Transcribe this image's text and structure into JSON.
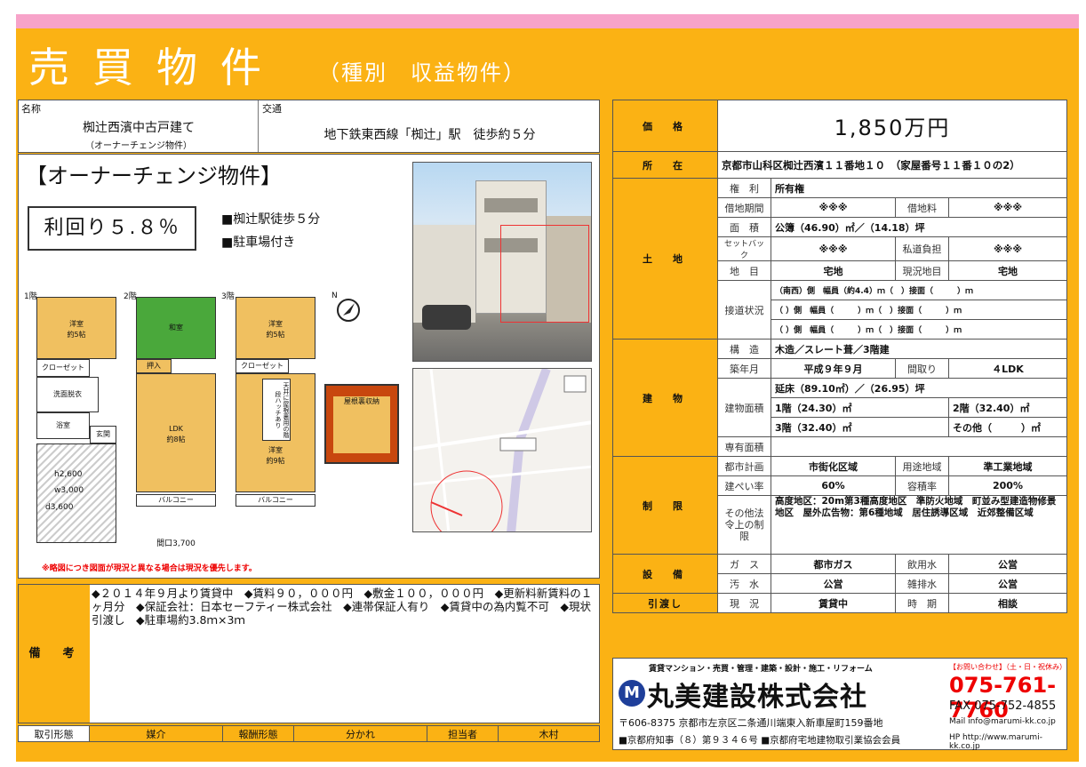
{
  "header": {
    "title": "売買物件",
    "subtitle": "（種別　収益物件）"
  },
  "name": {
    "label": "名称",
    "value": "椥辻西濱中古戸建て",
    "note": "（オーナーチェンジ物件）"
  },
  "access": {
    "label": "交通",
    "value": "地下鉄東西線「椥辻」駅　徒歩約５分"
  },
  "promo": {
    "heading": "【オーナーチェンジ物件】",
    "yield": "利回り５.８％",
    "point1": "■椥辻駅徒歩５分",
    "point2": "■駐車場付き"
  },
  "floorplan": {
    "f1": "1階",
    "f2": "2階",
    "f3": "3階",
    "r_youshitsu1": "洋室\n約5帖",
    "closet": "クローゼット",
    "washroom": "洗面脱衣",
    "bath": "浴室",
    "entrance": "玄関",
    "washitsu": "和室",
    "oshiire": "押入",
    "ldk": "LDK\n約8帖",
    "balcony": "バルコニー",
    "r_youshitsu3a": "洋室\n約5帖",
    "r_youshitsu3b": "洋室\n約9帖",
    "loft_note": "天井に屋根裏用の階段ハッチあり",
    "closet2": "クローゼット",
    "attic": "屋根裏収納",
    "h": "h2,600",
    "w": "w3,000",
    "d": "d3,600",
    "width": "間口3,700",
    "up": "UP",
    "dn": "DN",
    "north": "N",
    "disclaimer": "※略図につき図面が現況と異なる場合は現況を優先します。"
  },
  "price": {
    "label": "価　格",
    "value": "1,850万円"
  },
  "location": {
    "label": "所　在",
    "value": "京都市山科区椥辻西濱１１番地１０　（家屋番号１１番１０の2）"
  },
  "land": {
    "label": "土　地",
    "rights_l": "権　利",
    "rights": "所有権",
    "lease_period_l": "借地期間",
    "lease_period": "※※※",
    "lease_fee_l": "借地料",
    "lease_fee": "※※※",
    "area_l": "面　積",
    "area": "公簿（46.90）㎡／（14.18）坪",
    "setback_l": "セットバック",
    "setback": "※※※",
    "private_road_l": "私道負担",
    "private_road": "※※※",
    "category_l": "地　目",
    "category": "宅地",
    "current_l": "現況地目",
    "current": "宅地",
    "road_l": "接道状況",
    "road1": "（南西）側　幅員（約4.4）ｍ（　）接面（　　　）ｍ",
    "road2": "（ ）側　幅員（　　　）ｍ（　）接面（　　　）ｍ",
    "road3": "（ ）側　幅員（　　　）ｍ（　）接面（　　　）ｍ"
  },
  "building": {
    "label": "建　物",
    "struct_l": "構　造",
    "struct": "木造／スレート葺／3階建",
    "built_l": "築年月",
    "built": "平成９年９月",
    "layout_l": "間取り",
    "layout": "４LDK",
    "floor_area_l": "建物面積",
    "floor_total": "延床（89.10㎡）／（26.95）坪",
    "f1": "1階（24.30）㎡",
    "f2": "2階（32.40）㎡",
    "f3": "3階（32.40）㎡",
    "other": "その他（　　　）㎡",
    "exclusive_l": "専有面積",
    "exclusive": ""
  },
  "restriction": {
    "label": "制　限",
    "city_l": "都市計画",
    "city": "市街化区域",
    "zoning_l": "用途地域",
    "zoning": "準工業地域",
    "bcr_l": "建ぺい率",
    "bcr": "60%",
    "far_l": "容積率",
    "far": "200%",
    "other_l": "その他法令上の制限",
    "other": "高度地区：20m第3種高度地区　準防火地域　町並み型建造物修景地区　屋外広告物：第6種地域　居住誘導区域　近郊整備区域"
  },
  "facility": {
    "label": "設　備",
    "gas_l": "ガ　ス",
    "gas": "都市ガス",
    "water_l": "飲用水",
    "water": "公営",
    "sewage_l": "汚　水",
    "sewage": "公営",
    "drain_l": "雑排水",
    "drain": "公営"
  },
  "handover": {
    "label": "引渡し",
    "status_l": "現　況",
    "status": "賃貸中",
    "timing_l": "時　期",
    "timing": "相談"
  },
  "remarks": {
    "label": "備　考",
    "text": "◆２０１４年９月より賃貸中　◆賃料９０，０００円　◆敷金１００，０００円　◆更新料新賃料の１ヶ月分　◆保証会社：日本セーフティー株式会社　◆連帯保証人有り　◆賃貸中の為内覧不可　◆現状引渡し　◆駐車場約3.8ｍ×3ｍ"
  },
  "footer": {
    "transaction_l": "取引形態",
    "transaction": "媒介",
    "fee_l": "報酬形態",
    "fee": "分かれ",
    "staff_l": "担当者",
    "staff": "木村"
  },
  "company": {
    "tagline": "賃貸マンション・売買・管理・建築・設計・施工・リフォーム",
    "name": "丸美建設株式会社",
    "logo": "M",
    "contact_note": "【お問い合わせ】（土・日・祝休み）",
    "tel": "075-761-7760",
    "fax": "FAX 075-752-4855",
    "address": "〒606-8375 京都市左京区二条通川端東入新車屋町159番地",
    "license": "■京都府知事（８）第９３４６号 ■京都府宅地建物取引業協会会員",
    "mail": "Mail  info@marumi-kk.co.jp",
    "hp": "HP  http://www.marumi-kk.co.jp"
  },
  "colors": {
    "accent": "#fbb214",
    "pink": "#f7a3c9",
    "red": "#e00000",
    "blue": "#1f3f9a"
  }
}
